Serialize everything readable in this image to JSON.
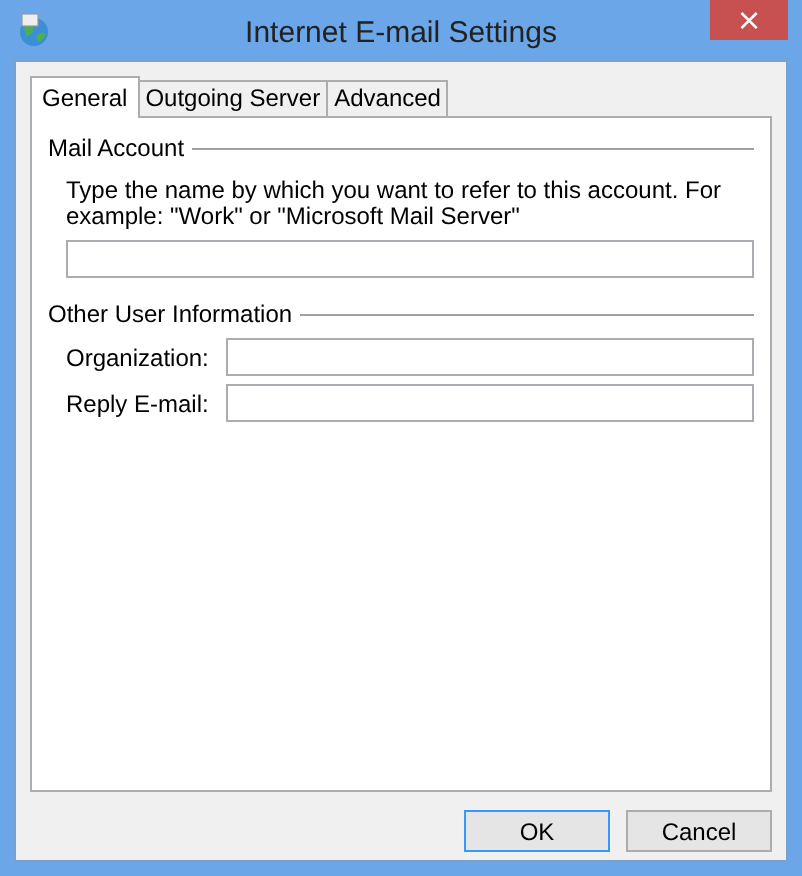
{
  "window": {
    "title": "Internet E-mail Settings",
    "close": "×"
  },
  "tabs": [
    {
      "label": "General",
      "selected": true
    },
    {
      "label": "Outgoing Server",
      "selected": false
    },
    {
      "label": "Advanced",
      "selected": false
    }
  ],
  "mail_account": {
    "heading": "Mail Account",
    "description": "Type the name by which you want to refer to this account. For example: \"Work\" or \"Microsoft Mail Server\""
  },
  "other_user_information": {
    "heading": "Other User Information",
    "fields": [
      {
        "label": "Organization:"
      },
      {
        "label": "Reply E-mail:"
      }
    ]
  },
  "buttons": [
    {
      "label": "OK",
      "default": true
    },
    {
      "label": "Cancel",
      "default": false
    }
  ]
}
